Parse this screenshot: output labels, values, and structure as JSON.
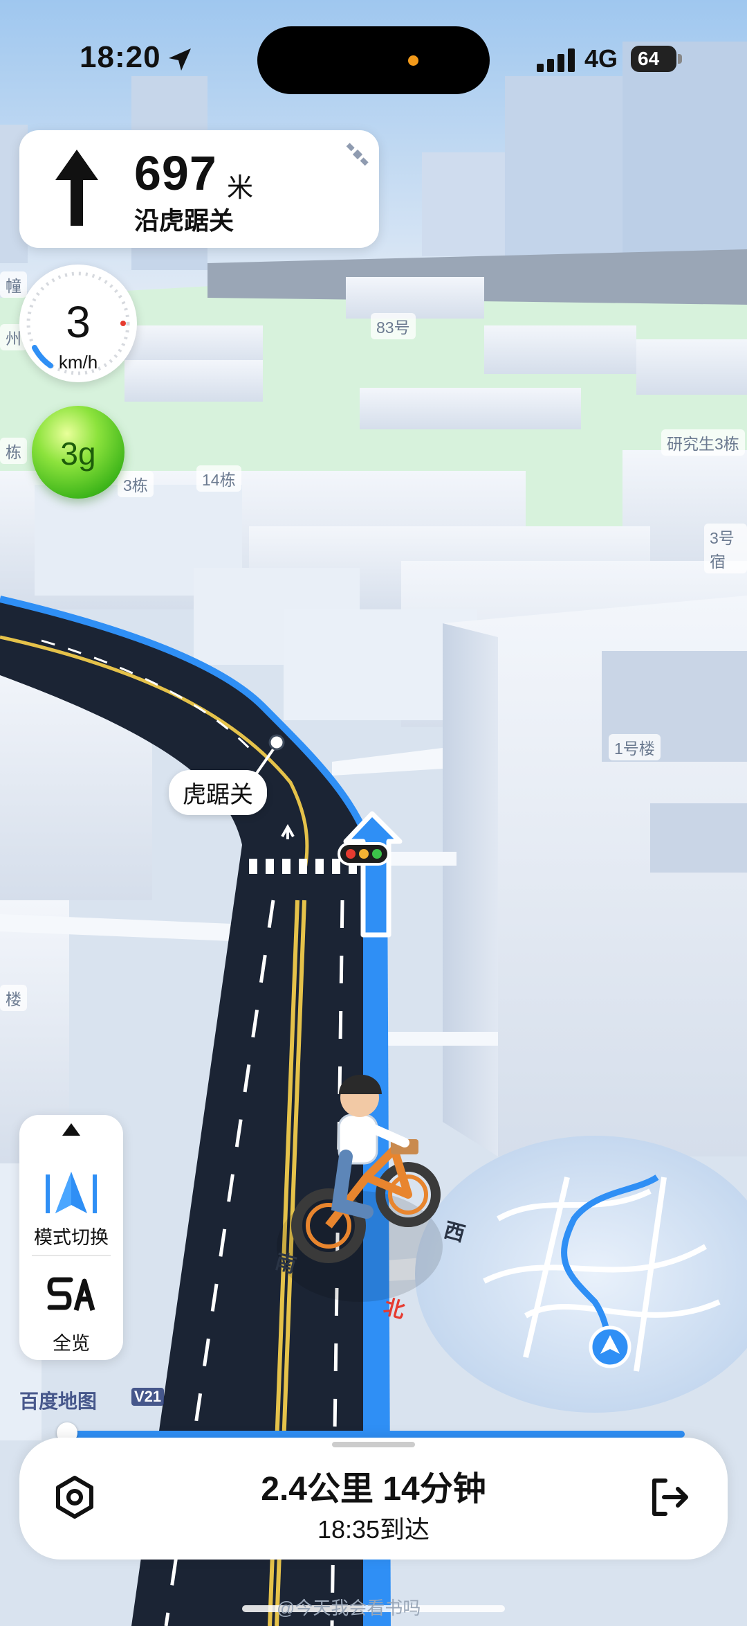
{
  "status_bar": {
    "time": "18:20",
    "network": "4G",
    "battery": "64"
  },
  "navigation": {
    "distance": "697",
    "unit": "米",
    "instruction": "沿虎踞关"
  },
  "speed": {
    "value": "3",
    "unit": "km/h"
  },
  "badge": {
    "text": "3g"
  },
  "map_labels": {
    "road_name": "虎踞关",
    "building_83": "83号",
    "building_14": "14栋",
    "building_3": "3栋",
    "graduate": "研究生3栋",
    "building_3_right": "3号宿",
    "building_1": "1号楼",
    "left_edge_1": "州",
    "left_edge_2": "幢",
    "left_edge_3": "栋",
    "left_edge_4": "楼",
    "compass_west": "西",
    "compass_north": "北",
    "compass_south": "南"
  },
  "controls": {
    "mode_label": "模式切换",
    "overview_label": "全览"
  },
  "brand": {
    "name": "百度地图",
    "version": "V21"
  },
  "trip": {
    "summary": "2.4公里 14分钟",
    "eta": "18:35到达"
  },
  "watermark": "@今天我会看书吗",
  "colors": {
    "route": "#2f8ff5",
    "road": "#1b2434",
    "green_area": "#d7f2dc"
  }
}
